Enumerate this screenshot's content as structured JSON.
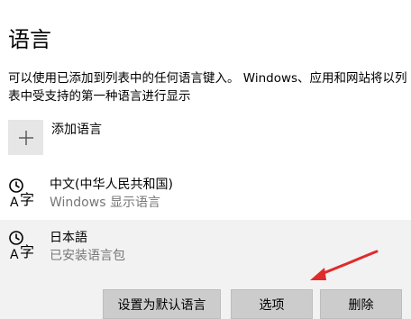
{
  "header": {
    "title": "语言",
    "description": "可以使用已添加到列表中的任何语言键入。 Windows、应用和网站将以列表中受支持的第一种语言进行显示"
  },
  "add_language": {
    "icon": "plus-icon",
    "label": "添加语言"
  },
  "languages": [
    {
      "name": "中文(中华人民共和国)",
      "status": "Windows 显示语言",
      "icon": "language-icon",
      "selected": false
    },
    {
      "name": "日本語",
      "status": "已安装语言包",
      "icon": "language-icon",
      "selected": true
    }
  ],
  "actions": {
    "set_default": "设置为默认语言",
    "options": "选项",
    "remove": "删除"
  },
  "colors": {
    "selected_row": "#f2f2f2",
    "button_bg": "#cccccc",
    "annotation_arrow": "#e02b2b"
  }
}
